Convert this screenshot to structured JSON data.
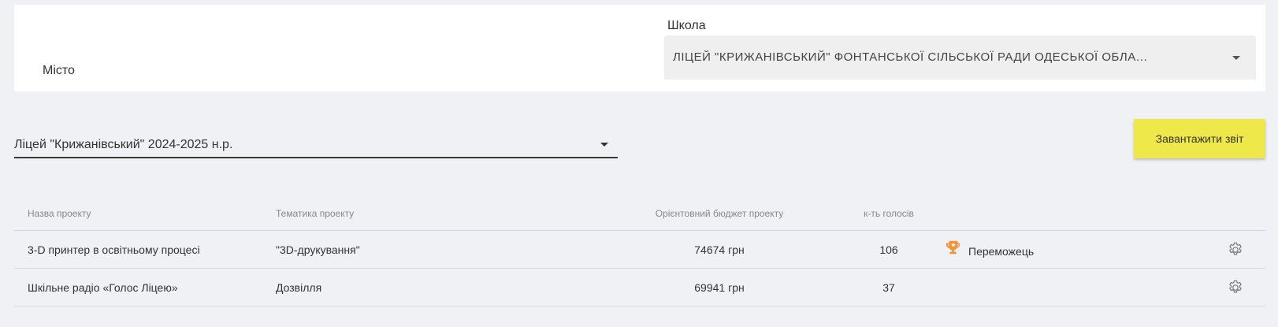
{
  "filters": {
    "city_label": "Місто",
    "school_label": "Школа",
    "school_value": "ЛІЦЕЙ \"КРИЖАНІВСЬКИЙ\" ФОНТАНСЬКОЇ СІЛЬСЬКОЇ РАДИ ОДЕСЬКОЇ ОБЛАСТІ"
  },
  "session": {
    "value": "Ліцей \"Крижанівський\" 2024-2025 н.р."
  },
  "download_button": "Завантажити звіт",
  "table": {
    "headers": {
      "name": "Назва проекту",
      "theme": "Тематика проекту",
      "budget": "Орієнтовний бюджет проекту",
      "votes": "к-ть голосів"
    },
    "rows": [
      {
        "name": "3-D принтер в освітньому процесі",
        "theme": "\"3D-друкування\"",
        "budget": "74674 грн",
        "votes": "106",
        "status": "Переможець"
      },
      {
        "name": "Шкільне радіо «Голос Ліцею»",
        "theme": "Дозвілля",
        "budget": "69941 грн",
        "votes": "37",
        "status": ""
      }
    ]
  },
  "icons": {
    "trophy": "trophy-icon",
    "gear": "gear-icon",
    "dropdown": "chevron-down-icon"
  },
  "colors": {
    "accent_button": "#efe84a",
    "trophy": "#f0943a",
    "background": "#f0f1f5"
  }
}
